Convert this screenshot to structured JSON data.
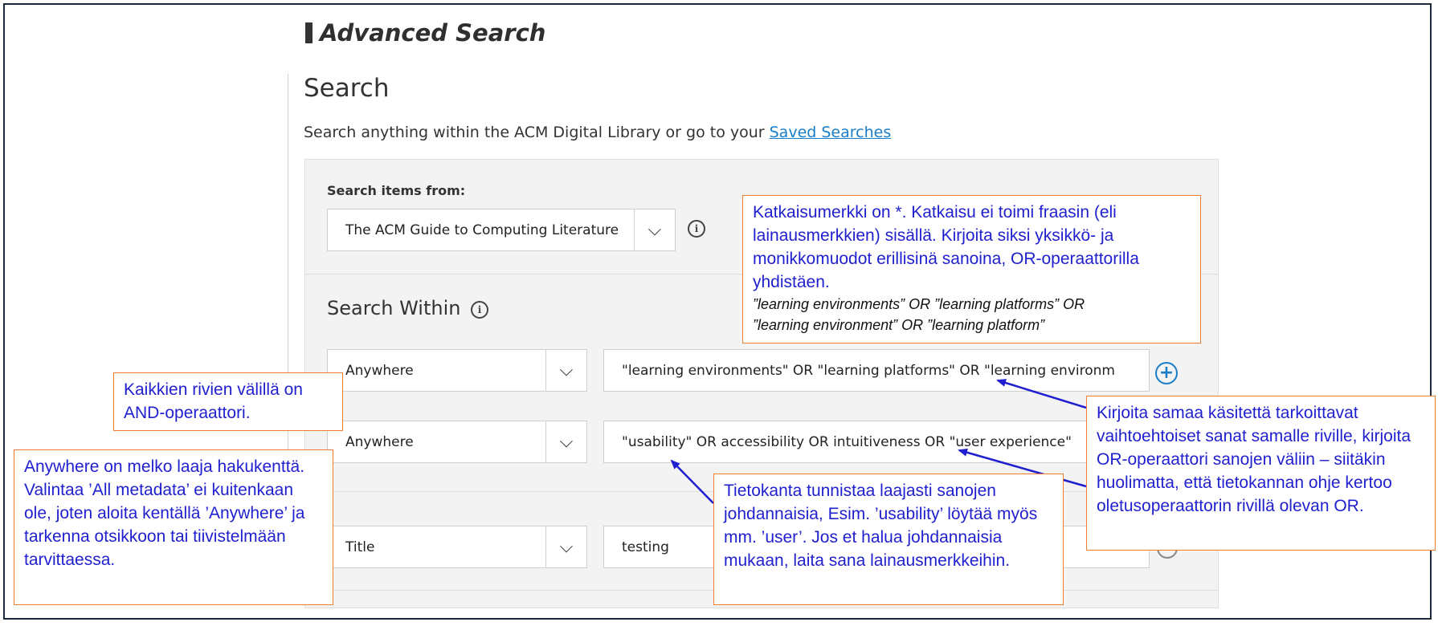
{
  "header": {
    "title": "Advanced Search"
  },
  "search": {
    "title": "Search",
    "description": "Search anything within the ACM Digital Library or go to your ",
    "saved_link": "Saved Searches"
  },
  "items_from": {
    "label": "Search items from:",
    "selected": "The ACM Guide to Computing Literature"
  },
  "search_within": {
    "title": "Search Within",
    "rows": [
      {
        "field": "Anywhere",
        "value": "\"learning environments\" OR \"learning platforms\" OR \"learning environm"
      },
      {
        "field": "Anywhere",
        "value": "\"usability\" OR accessibility OR intuitiveness OR \"user experience\""
      },
      {
        "field": "Title",
        "value": "testing"
      }
    ]
  },
  "notes": {
    "truncation": "Katkaisumerkki on *. Katkaisu ei toimi fraasin (eli lainausmerkkien) sisällä. Kirjoita siksi yksikkö- ja monikkomuodot erillisinä sanoina, OR-operaattorilla yhdistäen.",
    "truncation_example_1": "”learning environments” OR ”learning platforms” OR",
    "truncation_example_2": "”learning environment” OR ”learning platform”",
    "and_operator": "Kaikkien rivien välillä on AND-operaattori.",
    "anywhere": "Anywhere on melko laaja hakukenttä. Valintaa ’All metadata’ ei kuitenkaan ole, joten aloita kentällä ’Anywhere’ ja tarkenna otsikkoon tai tiivistelmään tarvittaessa.",
    "derivatives": "Tietokanta tunnistaa laajasti sanojen johdannaisia, Esim. ’usability’ löytää myös mm. ’user’. Jos et halua johdannaisia mukaan, laita sana lainausmerkkeihin.",
    "same_row": "Kirjoita samaa käsitettä tarkoittavat vaihtoehtoiset sanat samalle riville, kirjoita OR-operaattori sanojen väliin – siitäkin huolimatta, että tietokannan ohje kertoo oletusoperaattorin rivillä olevan OR."
  },
  "colors": {
    "note_text": "#1f1fd0",
    "note_border": "#ed7d31",
    "link": "#1a7dc8",
    "arrow": "#1f1fd0"
  },
  "icons": {
    "chevron": "chevron-down-icon",
    "info": "info-icon",
    "add": "plus-circle-icon",
    "remove": "minus-circle-icon"
  }
}
